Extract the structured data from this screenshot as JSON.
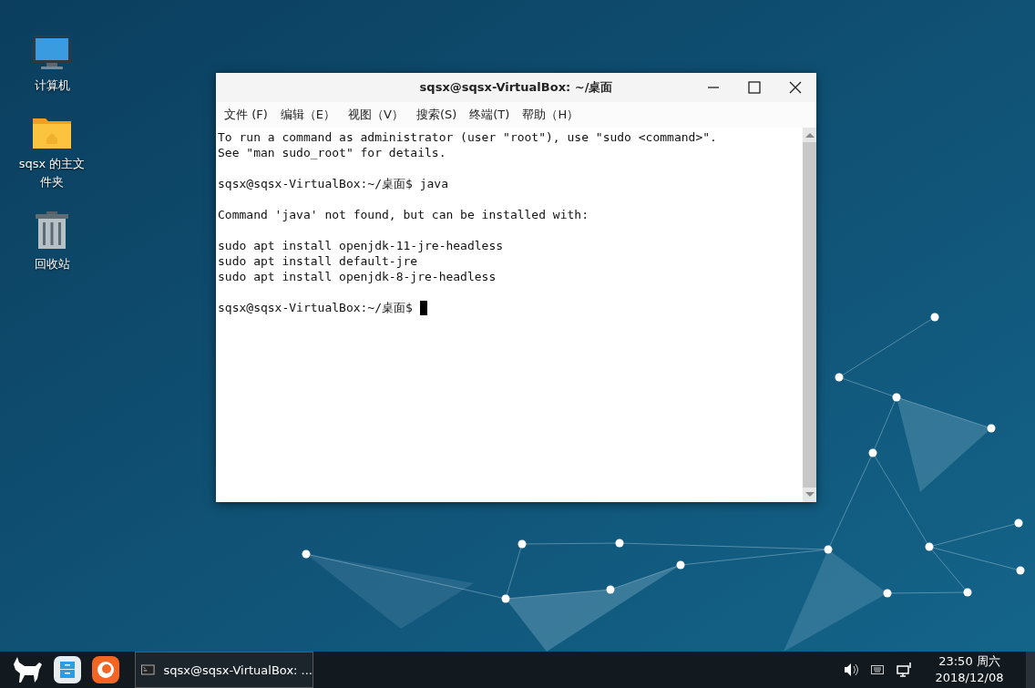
{
  "desktop_icons": [
    {
      "kind": "computer",
      "label": "计算机"
    },
    {
      "kind": "home",
      "label": "sqsx 的主文件夹"
    },
    {
      "kind": "trash",
      "label": "回收站"
    }
  ],
  "window": {
    "title": "sqsx@sqsx-VirtualBox: ~/桌面",
    "menu": [
      "文件 (F)",
      "编辑（E）",
      "视图（V）",
      "搜索(S)",
      "终端(T)",
      "帮助（H）"
    ],
    "terminal": {
      "blocks": [
        [
          "To run a command as administrator (user \"root\"), use \"sudo <command>\".",
          "See \"man sudo_root\" for details."
        ],
        [
          "sqsx@sqsx-VirtualBox:~/桌面$ java"
        ],
        [
          "Command 'java' not found, but can be installed with:"
        ],
        [
          "sudo apt install openjdk-11-jre-headless",
          "sudo apt install default-jre",
          "sudo apt install openjdk-8-jre-headless"
        ]
      ],
      "prompt": "sqsx@sqsx-VirtualBox:~/桌面$"
    }
  },
  "taskbar": {
    "launchers": [
      {
        "kind": "start"
      },
      {
        "kind": "files"
      },
      {
        "kind": "browser"
      }
    ],
    "tasks": [
      {
        "label": "sqsx@sqsx-VirtualBox: ...",
        "selected": true
      }
    ],
    "clock": {
      "time": "23:50 周六",
      "date": "2018/12/08"
    }
  }
}
